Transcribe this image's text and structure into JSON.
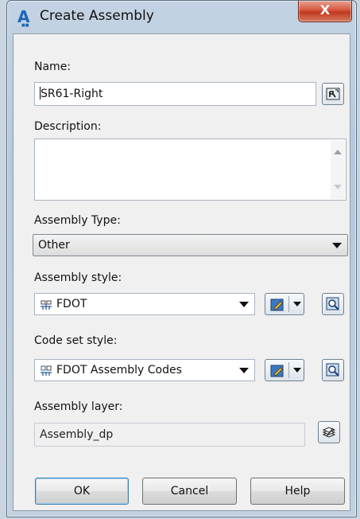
{
  "window": {
    "title": "Create Assembly",
    "close_glyph": "X",
    "app_icon": "A"
  },
  "name": {
    "label": "Name:",
    "value": "SR61-Right",
    "picker_icon": "name-template-icon"
  },
  "description": {
    "label": "Description:",
    "value": ""
  },
  "assembly_type": {
    "label": "Assembly Type:",
    "selected": "Other"
  },
  "assembly_style": {
    "label": "Assembly style:",
    "selected": "FDOT"
  },
  "code_set_style": {
    "label": "Code set style:",
    "selected": "FDOT Assembly Codes"
  },
  "assembly_layer": {
    "label": "Assembly layer:",
    "value": "Assembly_dp"
  },
  "buttons": {
    "ok": "OK",
    "cancel": "Cancel",
    "help": "Help"
  }
}
